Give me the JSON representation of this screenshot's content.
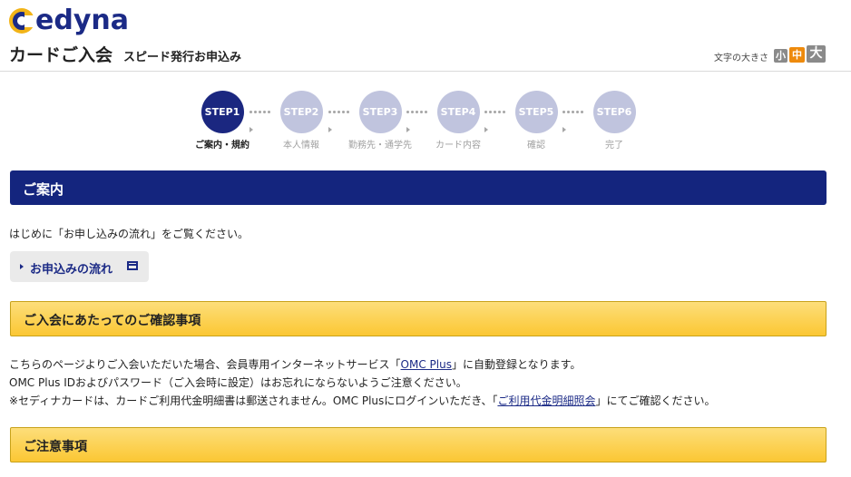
{
  "header": {
    "logo_text": "edyna",
    "title": "カードご入会",
    "subtitle": "スピード発行お申込み"
  },
  "font_size": {
    "label": "文字の大きさ",
    "small": "小",
    "medium": "中",
    "large": "大"
  },
  "steps": [
    {
      "label": "STEP1",
      "caption": "ご案内・規約"
    },
    {
      "label": "STEP2",
      "caption": "本人情報"
    },
    {
      "label": "STEP3",
      "caption": "勤務先・通学先"
    },
    {
      "label": "STEP4",
      "caption": "カード内容"
    },
    {
      "label": "STEP5",
      "caption": "確認"
    },
    {
      "label": "STEP6",
      "caption": "完了"
    }
  ],
  "guide": {
    "heading": "ご案内",
    "intro": "はじめに「お申し込みの流れ」をご覧ください。",
    "flow_button": "お申込みの流れ"
  },
  "confirm": {
    "heading": "ご入会にあたってのご確認事項",
    "line1_pre": "こちらのページよりご入会いただいた場合、会員専用インターネットサービス「",
    "line1_link": "OMC Plus",
    "line1_post": "」に自動登録となります。",
    "line2": "OMC Plus IDおよびパスワード（ご入会時に設定）はお忘れにならないようご注意ください。",
    "line3_pre": "※セディナカードは、カードご利用代金明細書は郵送されません。OMC Plusにログインいただき、「",
    "line3_link": "ご利用代金明細照会",
    "line3_post": "」にてご確認ください。"
  },
  "notes": {
    "heading": "ご注意事項"
  },
  "colors": {
    "navy": "#14257e",
    "step_active": "#1b2780",
    "step_inactive": "#c0c4de",
    "yellow": "#fbc733",
    "logo_yellow": "#f2b418"
  }
}
